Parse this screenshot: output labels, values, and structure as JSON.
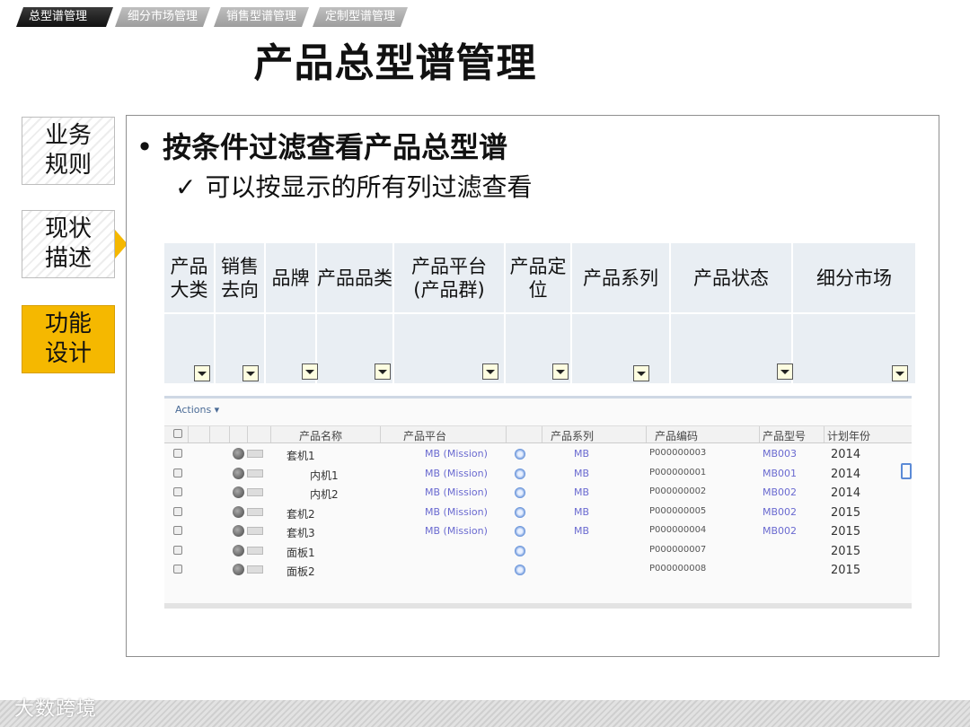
{
  "tabs": [
    {
      "label": "总型谱管理",
      "active": true
    },
    {
      "label": "细分市场管理",
      "active": false
    },
    {
      "label": "销售型谱管理",
      "active": false
    },
    {
      "label": "定制型谱管理",
      "active": false
    }
  ],
  "page_title": "产品总型谱管理",
  "side_nav": [
    {
      "line1": "业务",
      "line2": "规则",
      "active": false
    },
    {
      "line1": "现状",
      "line2": "描述",
      "active": false
    },
    {
      "line1": "功能",
      "line2": "设计",
      "active": true
    }
  ],
  "content": {
    "bullet": "按条件过滤查看产品总型谱",
    "check_mark": "✓",
    "check_text": "可以按显示的所有列过滤查看"
  },
  "filter_columns": [
    {
      "line1": "产品",
      "line2": "大类"
    },
    {
      "line1": "销售",
      "line2": "去向"
    },
    {
      "line1": "品牌",
      "line2": ""
    },
    {
      "line1": "产品品类",
      "line2": ""
    },
    {
      "line1": "产品平台",
      "line2": "(产品群)"
    },
    {
      "line1": "产品定",
      "line2": "位"
    },
    {
      "line1": "产品系列",
      "line2": ""
    },
    {
      "line1": "产品状态",
      "line2": ""
    },
    {
      "line1": "细分市场",
      "line2": ""
    }
  ],
  "grid": {
    "actions_label": "Actions ▾",
    "headers": [
      "产品名称",
      "产品平台",
      "产品系列",
      "产品编码",
      "产品型号",
      "计划年份"
    ],
    "rows": [
      {
        "name": "套机1",
        "platform": "MB (Mission)",
        "series": "MB",
        "code": "P000000003",
        "model": "MB003",
        "year": "2014"
      },
      {
        "name": "内机1",
        "platform": "MB (Mission)",
        "series": "MB",
        "code": "P000000001",
        "model": "MB001",
        "year": "2014"
      },
      {
        "name": "内机2",
        "platform": "MB (Mission)",
        "series": "MB",
        "code": "P000000002",
        "model": "MB002",
        "year": "2014"
      },
      {
        "name": "套机2",
        "platform": "MB (Mission)",
        "series": "MB",
        "code": "P000000005",
        "model": "MB002",
        "year": "2015"
      },
      {
        "name": "套机3",
        "platform": "MB (Mission)",
        "series": "MB",
        "code": "P000000004",
        "model": "MB002",
        "year": "2015"
      },
      {
        "name": "面板1",
        "platform": "",
        "series": "",
        "code": "P000000007",
        "model": "",
        "year": "2015"
      },
      {
        "name": "面板2",
        "platform": "",
        "series": "",
        "code": "P000000008",
        "model": "",
        "year": "2015"
      }
    ]
  },
  "footer": {
    "logo": "大数跨境"
  },
  "colors": {
    "accent": "#f5b800",
    "tab_active": "#1a1a1a",
    "tab_inactive": "#a8a8a8",
    "header_bg": "#e9eef3"
  }
}
